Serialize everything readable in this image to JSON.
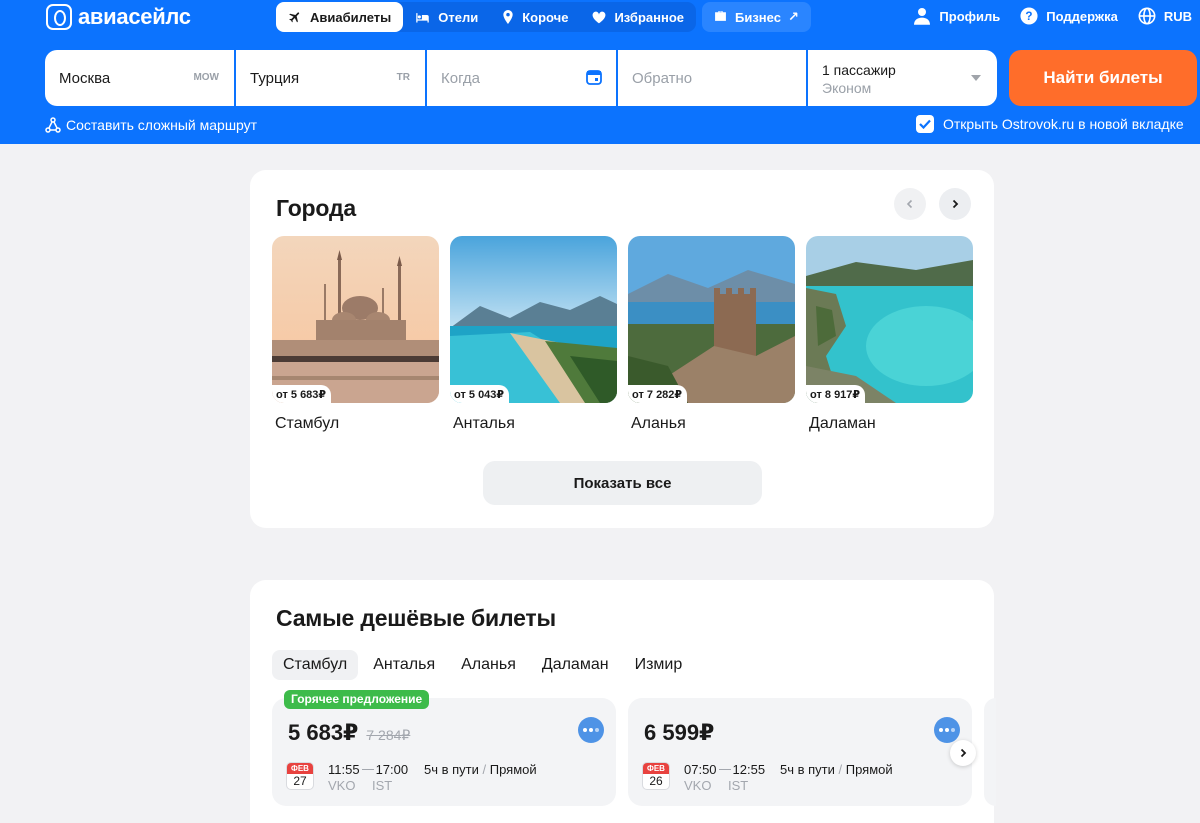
{
  "brand": {
    "name": "авиасейлс",
    "accent": "#0c73fe",
    "cta": "#ff6d2a"
  },
  "nav": {
    "items": [
      {
        "label": "Авиабилеты",
        "icon": "plane-icon",
        "active": true
      },
      {
        "label": "Отели",
        "icon": "bed-icon",
        "active": false
      },
      {
        "label": "Короче",
        "icon": "pin-icon",
        "active": false
      },
      {
        "label": "Избранное",
        "icon": "heart-icon",
        "active": false
      }
    ],
    "business": {
      "label": "Бизнес",
      "icon": "briefcase-icon"
    }
  },
  "user_nav": {
    "profile": "Профиль",
    "support": "Поддержка",
    "currency": "RUB"
  },
  "search": {
    "from": {
      "value": "Москва",
      "code": "MOW"
    },
    "to": {
      "value": "Турция",
      "code": "TR"
    },
    "when_placeholder": "Когда",
    "return_placeholder": "Обратно",
    "passengers": "1 пассажир",
    "class": "Эконом",
    "submit": "Найти билеты",
    "complex_route": "Составить сложный маршрут",
    "ostrovok": "Открыть Ostrovok.ru в новой вкладке",
    "ostrovok_checked": true
  },
  "cities": {
    "title": "Города",
    "show_all": "Показать все",
    "items": [
      {
        "name": "Стамбул",
        "price": "от 5 683₽",
        "image": "istanbul-mosque-photo"
      },
      {
        "name": "Анталья",
        "price": "от 5 043₽",
        "image": "antalya-coast-photo"
      },
      {
        "name": "Аланья",
        "price": "от 7 282₽",
        "image": "alanya-fortress-photo"
      },
      {
        "name": "Даламан",
        "price": "от 8 917₽",
        "image": "dalaman-lagoon-photo"
      }
    ]
  },
  "cheapest": {
    "title": "Самые дешёвые билеты",
    "tabs": [
      "Стамбул",
      "Анталья",
      "Аланья",
      "Даламан",
      "Измир"
    ],
    "active_tab": 0,
    "tickets": [
      {
        "badge": "Горячее предложение",
        "price": "5 683₽",
        "old_price": "7 284₽",
        "month": "ФЕВ",
        "day": "27",
        "dep_time": "11:55",
        "arr_time": "17:00",
        "dep_code": "VKO",
        "arr_code": "IST",
        "duration": "5ч в пути",
        "stops": "Прямой"
      },
      {
        "price": "6 599₽",
        "month": "ФЕВ",
        "day": "26",
        "dep_time": "07:50",
        "arr_time": "12:55",
        "dep_code": "VKO",
        "arr_code": "IST",
        "duration": "5ч в пути",
        "stops": "Прямой"
      }
    ]
  }
}
